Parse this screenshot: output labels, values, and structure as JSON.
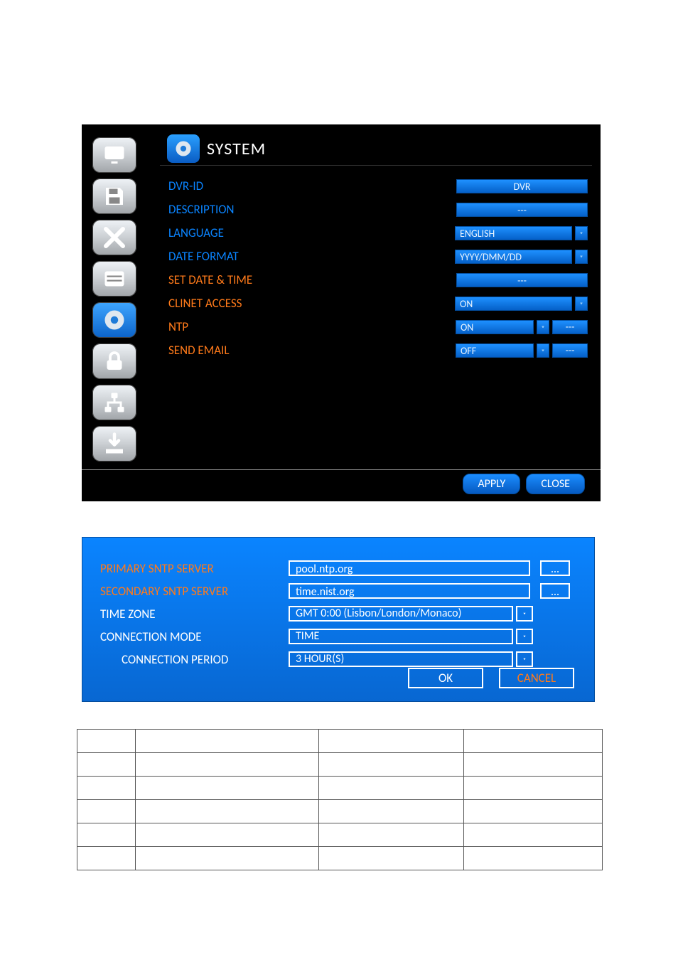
{
  "header": {
    "title": "SYSTEM"
  },
  "system_rows": {
    "dvr_id_label": "DVR-ID",
    "dvr_id_value": "DVR",
    "description_label": "DESCRIPTION",
    "description_value": "---",
    "language_label": "LANGUAGE",
    "language_value": "ENGLISH",
    "date_format_label": "DATE FORMAT",
    "date_format_value": "YYYY/DMM/DD",
    "set_date_time_label": "SET DATE & TIME",
    "set_date_time_value": "---",
    "client_access_label": "CLINET ACCESS",
    "client_access_value": "ON",
    "ntp_label": "NTP",
    "ntp_value": "ON",
    "ntp_extra": "---",
    "send_email_label": "SEND EMAIL",
    "send_email_value": "OFF",
    "send_email_extra": "---"
  },
  "buttons": {
    "apply": "APPLY",
    "close": "CLOSE"
  },
  "ntp_dialog": {
    "primary_label": "PRIMARY SNTP SERVER",
    "primary_value": "pool.ntp.org",
    "secondary_label": "SECONDARY  SNTP SERVER",
    "secondary_value": "time.nist.org",
    "timezone_label": "TIME ZONE",
    "timezone_value": "GMT 0:00 (Lisbon/London/Monaco)",
    "conn_mode_label": "CONNECTION MODE",
    "conn_mode_value": "TIME",
    "conn_period_label": "CONNECTION PERIOD",
    "conn_period_value": "3 HOUR(S)",
    "ellipsis": "…",
    "ok": "OK",
    "cancel": "CANCEL"
  }
}
